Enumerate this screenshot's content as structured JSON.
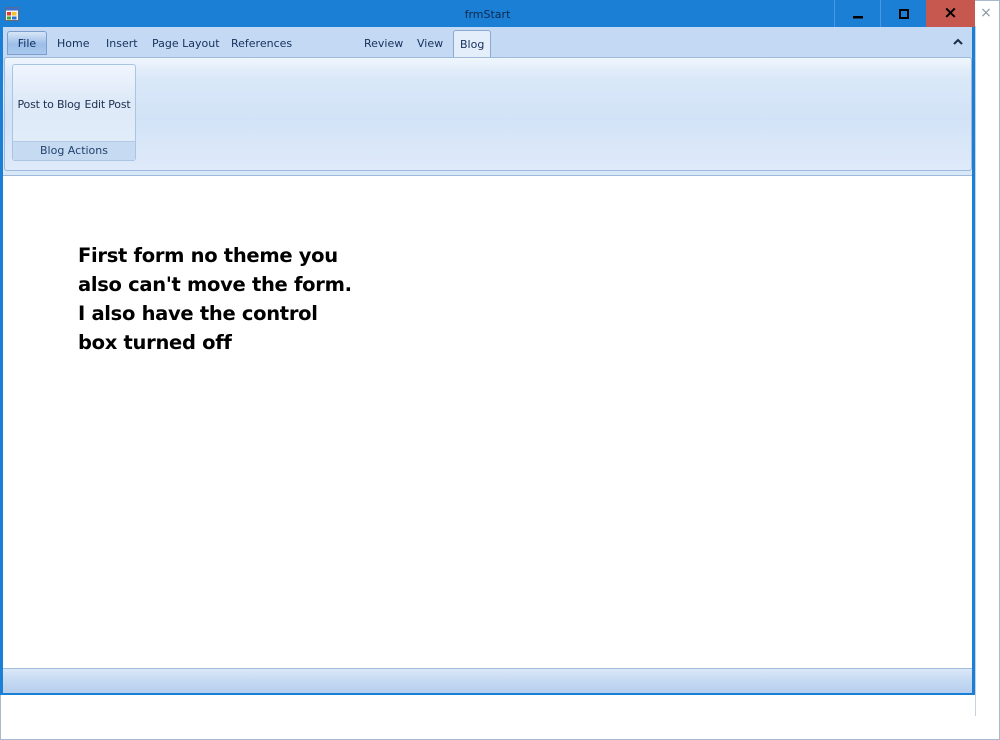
{
  "window": {
    "title": "frmStart",
    "close_glyph": "×",
    "background_close_glyph": "×"
  },
  "ribbon": {
    "tabs": [
      {
        "label": "File"
      },
      {
        "label": "Home"
      },
      {
        "label": "Insert"
      },
      {
        "label": "Page Layout"
      },
      {
        "label": "References"
      },
      {
        "label": "Review"
      },
      {
        "label": "View"
      },
      {
        "label": "Blog"
      }
    ],
    "active_tab": "Blog",
    "group": {
      "label": "Blog Actions",
      "buttons": [
        {
          "label": "Post to Blog"
        },
        {
          "label": "Edit Post"
        }
      ]
    }
  },
  "content": {
    "message_lines": [
      "First form no theme you",
      "also can't move the form.",
      "I also have the control",
      "box turned off"
    ]
  },
  "colors": {
    "title_bar": "#1c7fd6",
    "close_button": "#c7584f",
    "ribbon": "#c4daf4"
  }
}
